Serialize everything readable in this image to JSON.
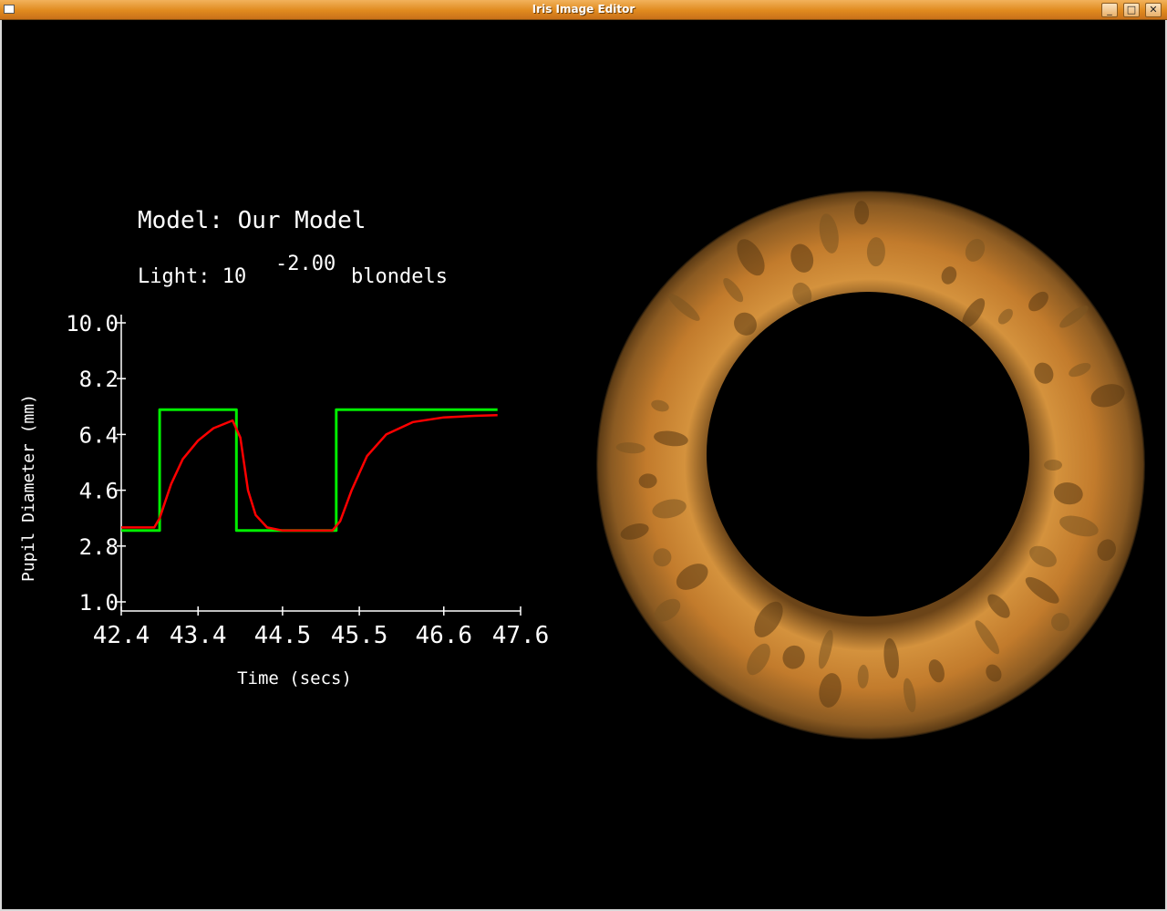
{
  "window": {
    "title": "Iris Image Editor"
  },
  "header": {
    "model_label": "Model: Our Model",
    "light_prefix": "Light: 10",
    "light_exponent": "-2.00",
    "light_suffix": "blondels"
  },
  "chart_data": {
    "type": "line",
    "title": "",
    "xlabel": "Time (secs)",
    "ylabel": "Pupil Diameter (mm)",
    "xlim": [
      42.4,
      47.6
    ],
    "ylim": [
      1.0,
      10.0
    ],
    "x_ticks": [
      "42.4",
      "43.4",
      "44.5",
      "45.5",
      "46.6",
      "47.6"
    ],
    "y_ticks": [
      "10.0",
      "8.2",
      "6.4",
      "4.6",
      "2.8",
      "1.0"
    ],
    "grid": false,
    "series": [
      {
        "color": "#00ee00",
        "points": [
          [
            42.4,
            3.3
          ],
          [
            42.9,
            3.3
          ],
          [
            42.9,
            7.2
          ],
          [
            43.9,
            7.2
          ],
          [
            43.9,
            3.3
          ],
          [
            45.2,
            3.3
          ],
          [
            45.2,
            7.2
          ],
          [
            47.3,
            7.2
          ]
        ]
      },
      {
        "color": "#ff0000",
        "points": [
          [
            42.4,
            3.4
          ],
          [
            42.83,
            3.4
          ],
          [
            42.9,
            3.7
          ],
          [
            43.05,
            4.8
          ],
          [
            43.2,
            5.6
          ],
          [
            43.4,
            6.2
          ],
          [
            43.6,
            6.6
          ],
          [
            43.85,
            6.85
          ],
          [
            43.95,
            6.3
          ],
          [
            44.05,
            4.6
          ],
          [
            44.15,
            3.8
          ],
          [
            44.3,
            3.4
          ],
          [
            44.5,
            3.3
          ],
          [
            45.15,
            3.3
          ],
          [
            45.25,
            3.6
          ],
          [
            45.4,
            4.6
          ],
          [
            45.6,
            5.7
          ],
          [
            45.85,
            6.4
          ],
          [
            46.2,
            6.8
          ],
          [
            46.6,
            6.95
          ],
          [
            47.0,
            7.0
          ],
          [
            47.3,
            7.02
          ]
        ]
      }
    ]
  },
  "iris": {
    "outer_color": "#c98432",
    "pupil_color": "#000000"
  }
}
